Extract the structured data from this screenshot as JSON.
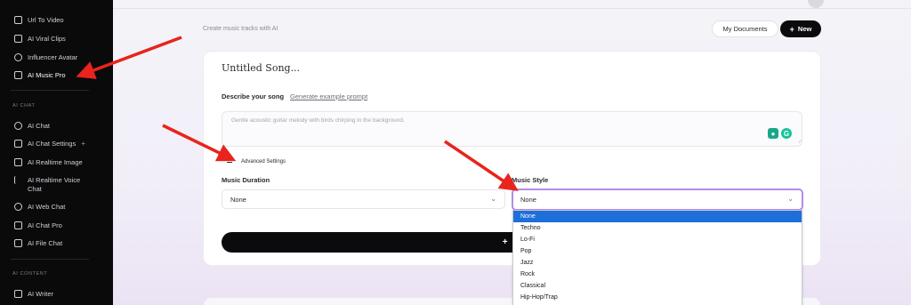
{
  "sidebar": {
    "items_top": [
      {
        "label": "Url To Video",
        "icon": "video-icon"
      },
      {
        "label": "AI Viral Clips",
        "icon": "film-icon"
      },
      {
        "label": "Influencer Avatar",
        "icon": "avatar-icon"
      },
      {
        "label": "AI Music Pro",
        "icon": "music-note-icon"
      }
    ],
    "section_chat": "AI CHAT",
    "items_chat": [
      {
        "label": "AI Chat",
        "icon": "chat-bubble-icon"
      },
      {
        "label": "AI Chat Settings",
        "icon": "chat-settings-icon",
        "extra": "+"
      },
      {
        "label": "AI Realtime Image",
        "icon": "realtime-image-icon"
      },
      {
        "label": "AI Realtime Voice",
        "label2": "Chat",
        "icon": "waveform-icon"
      },
      {
        "label": "AI Web Chat",
        "icon": "globe-icon"
      },
      {
        "label": "AI Chat Pro",
        "icon": "chat-pro-icon"
      },
      {
        "label": "AI File Chat",
        "icon": "file-chat-icon"
      }
    ],
    "section_content": "AI CONTENT",
    "items_content": [
      {
        "label": "AI Writer",
        "icon": "writer-icon"
      }
    ]
  },
  "header": {
    "subtitle": "Create music tracks with AI",
    "my_documents": "My Documents",
    "new_label": "New"
  },
  "card": {
    "song_title": "Untitled Song...",
    "describe_label": "Describe your song",
    "generate_prompt_link": "Generate example prompt",
    "prompt_placeholder": "Gentle acoustic guitar melody with birds chirping in the background.",
    "advanced_settings": "Advanced Settings",
    "music_duration_label": "Music Duration",
    "music_duration_value": "None",
    "music_style_label": "Music Style",
    "music_style_value": "None",
    "generate_label": "Ge"
  },
  "style_options": [
    "None",
    "Techno",
    "Lo-Fi",
    "Pop",
    "Jazz",
    "Rock",
    "Classical",
    "Hip-Hop/Trap"
  ],
  "colors": {
    "accent_red": "#e8241c",
    "focus_purple": "#b48be8",
    "selected_blue": "#1e6fd9"
  }
}
